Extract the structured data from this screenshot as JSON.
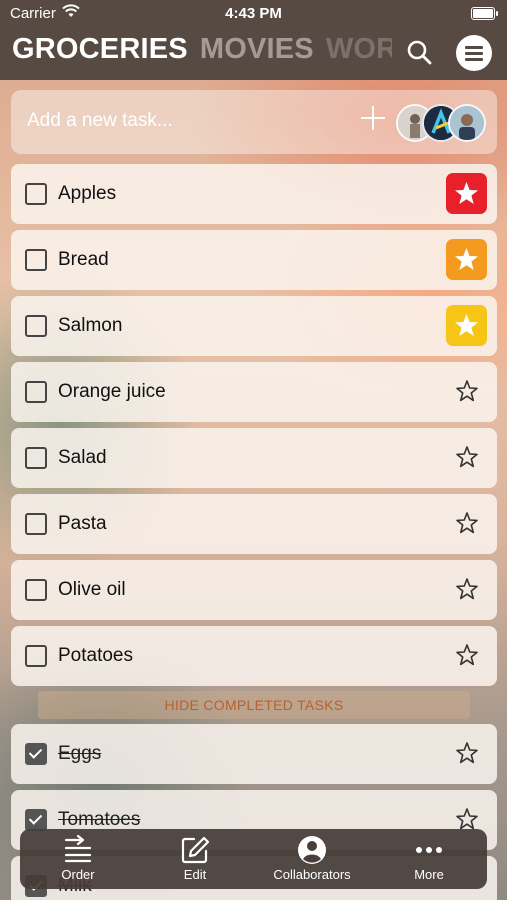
{
  "status": {
    "carrier": "Carrier",
    "time": "4:43 PM"
  },
  "tabs": [
    {
      "label": "GROCERIES"
    },
    {
      "label": "MOVIES"
    },
    {
      "label": "WORK"
    }
  ],
  "add_task": {
    "placeholder": "Add a new task..."
  },
  "tasks": [
    {
      "label": "Apples",
      "checked": false,
      "star": "red"
    },
    {
      "label": "Bread",
      "checked": false,
      "star": "orange"
    },
    {
      "label": "Salmon",
      "checked": false,
      "star": "yellow"
    },
    {
      "label": "Orange juice",
      "checked": false,
      "star": "none"
    },
    {
      "label": "Salad",
      "checked": false,
      "star": "none"
    },
    {
      "label": "Pasta",
      "checked": false,
      "star": "none"
    },
    {
      "label": "Olive oil",
      "checked": false,
      "star": "none"
    },
    {
      "label": "Potatoes",
      "checked": false,
      "star": "none"
    }
  ],
  "hide_completed_label": "HIDE COMPLETED TASKS",
  "completed_tasks": [
    {
      "label": "Eggs",
      "checked": true,
      "star": "none"
    },
    {
      "label": "Tomatoes",
      "checked": true,
      "star": "none"
    },
    {
      "label": "Milk",
      "checked": true,
      "star": "none"
    }
  ],
  "colors": {
    "star_red": "#e8202a",
    "star_orange": "#f39a1f",
    "star_yellow": "#f6c515",
    "topbar": "#574a43",
    "hide_text": "#b8622f"
  },
  "bottom_bar": {
    "order": "Order",
    "edit": "Edit",
    "collaborators": "Collaborators",
    "more": "More"
  }
}
